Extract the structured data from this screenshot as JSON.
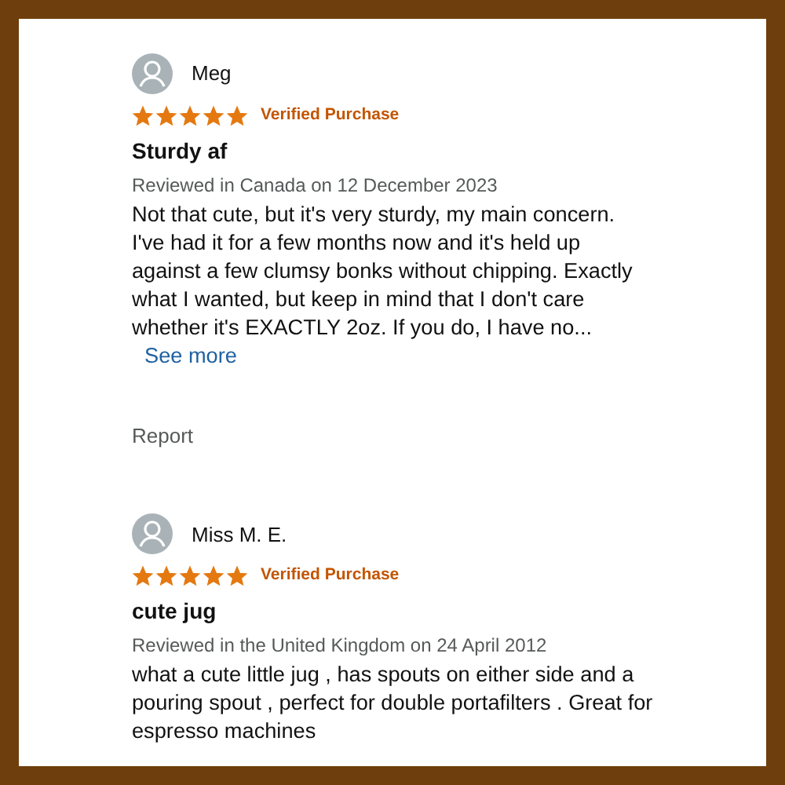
{
  "reviews": [
    {
      "author": "Meg",
      "stars": 5,
      "badge": "Verified Purchase",
      "title": "Sturdy af",
      "meta": "Reviewed in Canada on 12 December 2023",
      "body": "Not that cute, but it's very sturdy, my main concern. I've had it for a few months now and it's held up against a few clumsy bonks without chipping. Exactly what I wanted, but keep in mind that I don't care whether it's EXACTLY 2oz. If you do, I have no...",
      "see_more": "See more",
      "report": "Report"
    },
    {
      "author": "Miss M. E.",
      "stars": 5,
      "badge": "Verified Purchase",
      "title": "cute jug",
      "meta": "Reviewed in the United Kingdom on 24 April 2012",
      "body": "what a cute little jug , has spouts on either side and a pouring spout , perfect for double portafilters . Great for espresso machines"
    }
  ]
}
